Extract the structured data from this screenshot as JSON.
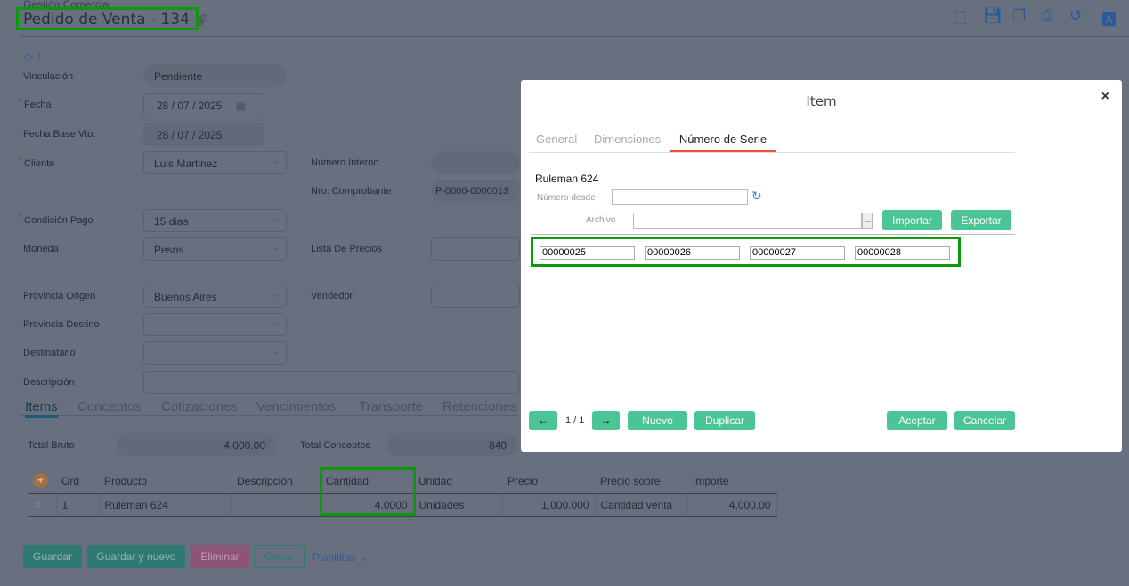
{
  "header": {
    "breadcrumb": "Gestión Comercial",
    "title": "Pedido de Venta - 134"
  },
  "toolbar": [
    "new-document-icon",
    "save-icon",
    "copy-icon",
    "print-icon",
    "history-icon",
    "pdf-icon"
  ],
  "form": {
    "vinculacion": {
      "label": "Vinculación",
      "value": "Pendiente"
    },
    "fecha": {
      "label": "Fecha",
      "value": "28 / 07 / 2025"
    },
    "fecha_base": {
      "label": "Fecha Base Vto.",
      "value": "28 / 07 / 2025"
    },
    "cliente": {
      "label": "Cliente",
      "value": "Luis Martinez"
    },
    "numero_interno": {
      "label": "Número Interno",
      "value": ""
    },
    "nro_comprobante": {
      "label": "Nro. Comprobante",
      "value": "P-0000-0000013"
    },
    "condicion_pago": {
      "label": "Condición Pago",
      "value": "15 dias"
    },
    "moneda": {
      "label": "Moneda",
      "value": "Pesos"
    },
    "lista_precios": {
      "label": "Lista De Precios",
      "value": ""
    },
    "provincia_origen": {
      "label": "Provincia Origen",
      "value": "Buenos Aires"
    },
    "vendedor": {
      "label": "Vendedor",
      "value": ""
    },
    "provincia_destino": {
      "label": "Provincia Destino",
      "value": ""
    },
    "destinatario": {
      "label": "Destinatario",
      "value": ""
    },
    "descripcion": {
      "label": "Descripción",
      "value": ""
    }
  },
  "tabs": [
    "Items",
    "Conceptos",
    "Cotizaciones",
    "Vencimientos",
    "Transporte",
    "Retenciones"
  ],
  "totals": {
    "bruto_label": "Total Bruto",
    "bruto": "4,000.00",
    "conceptos_label": "Total Conceptos",
    "conceptos": "840"
  },
  "items_table": {
    "headers": [
      "Ord",
      "Producto",
      "Descripción",
      "Cantidad",
      "Unidad",
      "Precio",
      "Precio sobre",
      "Importe"
    ],
    "rows": [
      [
        "1",
        "Ruleman 624",
        "",
        "4.0000",
        "Unidades",
        "1,000.000",
        "Cantidad venta",
        "4,000.00"
      ]
    ]
  },
  "actions": {
    "guardar": "Guardar",
    "guardar_nuevo": "Guardar y nuevo",
    "eliminar": "Eliminar",
    "cerrar": "Cerrar",
    "plantillas": "Plantillas"
  },
  "modal": {
    "title": "Item",
    "tabs": [
      "General",
      "Dimensiones",
      "Número de Serie"
    ],
    "active_tab": "Número de Serie",
    "product": "Ruleman 624",
    "numero_desde_label": "Número desde",
    "numero_desde": "",
    "archivo_label": "Archivo",
    "archivo": "",
    "importar": "Importar",
    "exportar": "Exportar",
    "serials": [
      "00000025",
      "00000026",
      "00000027",
      "00000028"
    ],
    "pager": "1 / 1",
    "nuevo": "Nuevo",
    "duplicar": "Duplicar",
    "aceptar": "Aceptar",
    "cancelar": "Cancelar"
  },
  "colors": {
    "accent_green": "#4cc596",
    "highlight": "#0a9a0a",
    "tab_active": "#e8533a",
    "link": "#2b6cb5"
  }
}
